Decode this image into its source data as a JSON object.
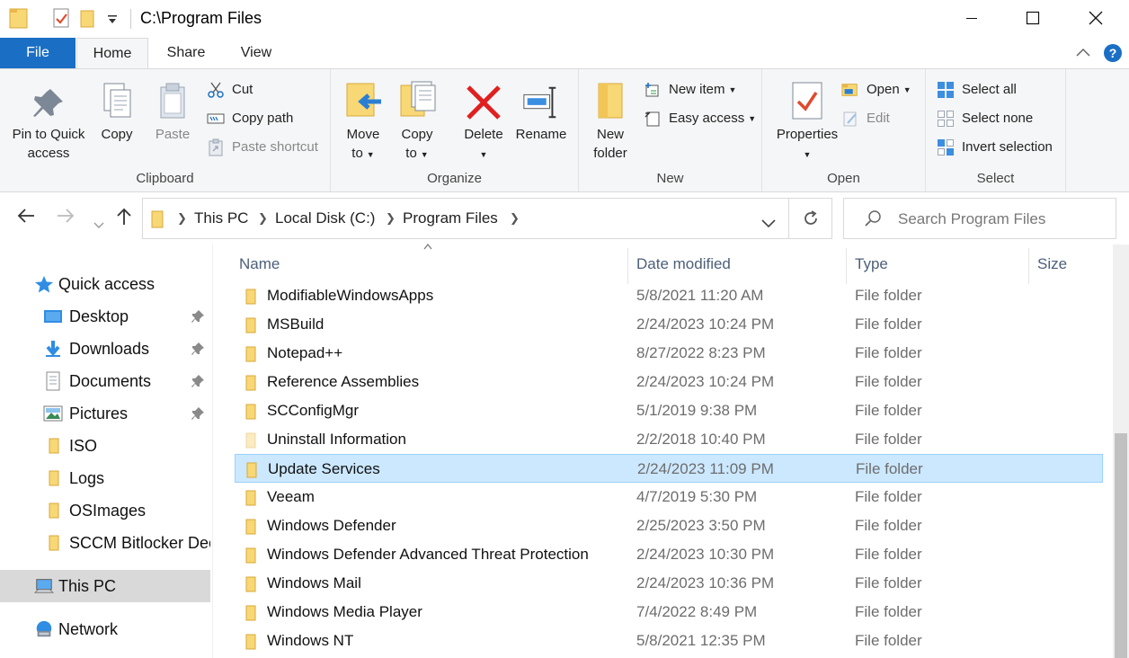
{
  "window": {
    "title": "C:\\Program Files",
    "controls": {
      "minimize": "minimize",
      "maximize": "maximize",
      "close": "close"
    }
  },
  "ribbon_tabs": [
    "File",
    "Home",
    "Share",
    "View"
  ],
  "ribbon": {
    "clipboard": {
      "label": "Clipboard",
      "pin_label_1": "Pin to Quick",
      "pin_label_2": "access",
      "copy": "Copy",
      "paste": "Paste",
      "cut": "Cut",
      "copy_path": "Copy path",
      "paste_shortcut": "Paste shortcut"
    },
    "organize": {
      "label": "Organize",
      "move_to_1": "Move",
      "move_to_2": "to",
      "copy_to_1": "Copy",
      "copy_to_2": "to",
      "delete": "Delete",
      "rename": "Rename"
    },
    "new": {
      "label": "New",
      "new_folder_1": "New",
      "new_folder_2": "folder",
      "new_item": "New item",
      "easy_access": "Easy access"
    },
    "open": {
      "label": "Open",
      "properties": "Properties",
      "open": "Open",
      "edit": "Edit"
    },
    "select": {
      "label": "Select",
      "select_all": "Select all",
      "select_none": "Select none",
      "invert_selection": "Invert selection"
    }
  },
  "address": {
    "crumbs": [
      "This PC",
      "Local Disk (C:)",
      "Program Files"
    ],
    "search_placeholder": "Search Program Files"
  },
  "nav": {
    "quick_access": "Quick access",
    "items": [
      "Desktop",
      "Downloads",
      "Documents",
      "Pictures",
      "ISO",
      "Logs",
      "OSImages",
      "SCCM Bitlocker Decr"
    ],
    "this_pc": "This PC",
    "network": "Network"
  },
  "columns": {
    "name": "Name",
    "date": "Date modified",
    "type": "Type",
    "size": "Size"
  },
  "files": [
    {
      "name": "ModifiableWindowsApps",
      "date": "5/8/2021 11:20 AM",
      "type": "File folder"
    },
    {
      "name": "MSBuild",
      "date": "2/24/2023 10:24 PM",
      "type": "File folder"
    },
    {
      "name": "Notepad++",
      "date": "8/27/2022 8:23 PM",
      "type": "File folder"
    },
    {
      "name": "Reference Assemblies",
      "date": "2/24/2023 10:24 PM",
      "type": "File folder"
    },
    {
      "name": "SCConfigMgr",
      "date": "5/1/2019 9:38 PM",
      "type": "File folder"
    },
    {
      "name": "Uninstall Information",
      "date": "2/2/2018 10:40 PM",
      "type": "File folder"
    },
    {
      "name": "Update Services",
      "date": "2/24/2023 11:09 PM",
      "type": "File folder"
    },
    {
      "name": "Veeam",
      "date": "4/7/2019 5:30 PM",
      "type": "File folder"
    },
    {
      "name": "Windows Defender",
      "date": "2/25/2023 3:50 PM",
      "type": "File folder"
    },
    {
      "name": "Windows Defender Advanced Threat Protection",
      "date": "2/24/2023 10:30 PM",
      "type": "File folder"
    },
    {
      "name": "Windows Mail",
      "date": "2/24/2023 10:36 PM",
      "type": "File folder"
    },
    {
      "name": "Windows Media Player",
      "date": "7/4/2022 8:49 PM",
      "type": "File folder"
    },
    {
      "name": "Windows NT",
      "date": "5/8/2021 12:35 PM",
      "type": "File folder"
    }
  ],
  "colors": {
    "accent": "#1a6fc4",
    "selection": "#cce8ff",
    "folder": "#f8d775"
  }
}
